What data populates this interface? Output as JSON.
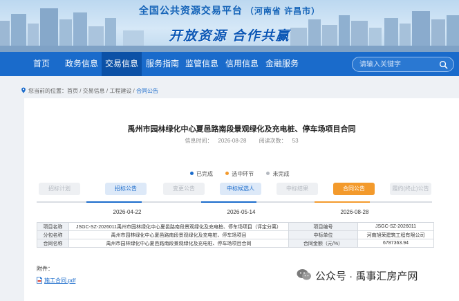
{
  "banner": {
    "title": "全国公共资源交易平台",
    "subtitle": "（河南省 许昌市）",
    "slogan": "开放资源 合作共赢"
  },
  "nav": {
    "items": [
      "首页",
      "政务信息",
      "交易信息",
      "服务指南",
      "监管信息",
      "信用信息",
      "金融服务"
    ],
    "active": "交易信息",
    "search_placeholder": "请输入关键字"
  },
  "breadcrumb": {
    "prefix": "您当前的位置：",
    "path": "首页 / 交易信息 / 工程建设 / ",
    "current": "合同公告"
  },
  "article": {
    "title": "禹州市园林绿化中心夏邑路南段景观绿化及充电桩、停车场项目合同",
    "publish_label": "信息时间：",
    "publish_date": "2026-08-28",
    "views_label": "阅读次数：",
    "views": "53"
  },
  "legend": [
    {
      "label": "已完成",
      "color": "#1a6bcb"
    },
    {
      "label": "选中环节",
      "color": "#f39a2c"
    },
    {
      "label": "未完成",
      "color": "#b4b9c0"
    }
  ],
  "steps": [
    {
      "label": "招标计划",
      "state": "todo"
    },
    {
      "label": "招标公告",
      "state": "done"
    },
    {
      "label": "变更公告",
      "state": "todo"
    },
    {
      "label": "中标候选人",
      "state": "done"
    },
    {
      "label": "中标结果",
      "state": "todo"
    },
    {
      "label": "合同公告",
      "state": "selected"
    },
    {
      "label": "履约(终止)公告",
      "state": "todo"
    }
  ],
  "dates": [
    "2026-04-22",
    "2026-05-14",
    "2026-08-28"
  ],
  "table": {
    "rows": [
      {
        "k1": "项目名称",
        "v1": "JSGC-SZ-2026011禹州市园林绿化中心夏邑路南段景观绿化及充电桩、停车场项目（评定分离）",
        "k2": "项目编号",
        "v2": "JSGC-SZ-2026011"
      },
      {
        "k1": "分包名称",
        "v1": "禹州市园林绿化中心夏邑路南段景观绿化及充电桩、停车场项目",
        "k2": "中标单位",
        "v2": "河南旭荣建筑工程有限公司"
      },
      {
        "k1": "合同名称",
        "v1": "禹州市园林绿化中心夏邑路南段景观绿化及充电桩、停车场项目合同",
        "k2": "合同金额（元/%）",
        "v2": "6787363.94"
      }
    ]
  },
  "attachment": {
    "label": "附件：",
    "file": "施工合同.pdf"
  },
  "watermark": {
    "text": "公众号 · 禹事汇房产网"
  }
}
